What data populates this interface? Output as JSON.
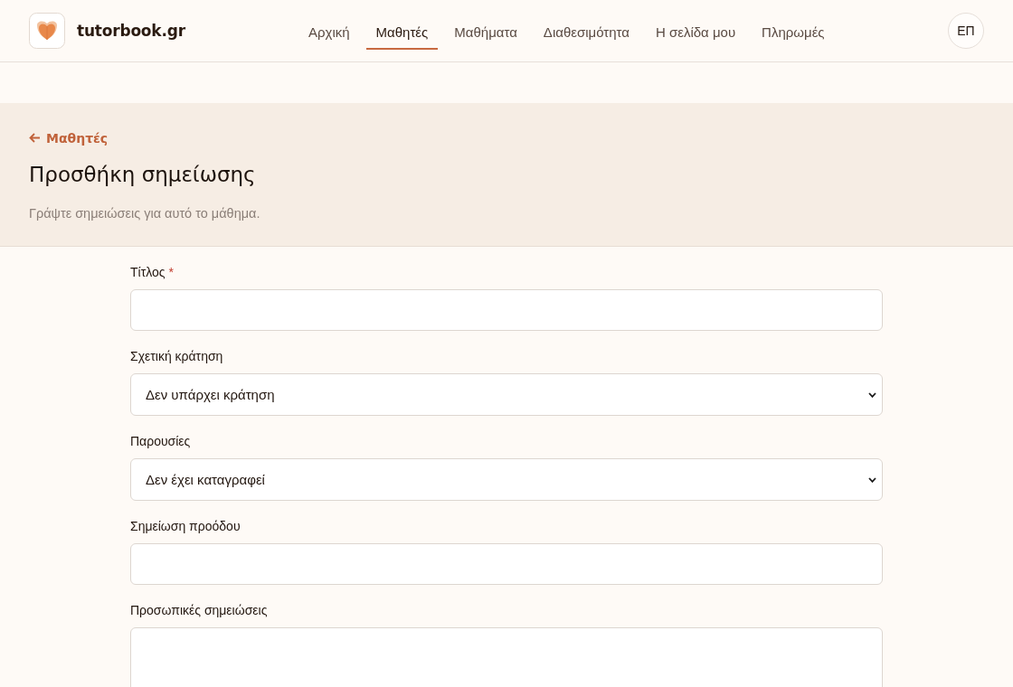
{
  "header": {
    "brand": "tutorbook.gr",
    "nav": [
      {
        "label": "Αρχική",
        "selected": false
      },
      {
        "label": "Μαθητές",
        "selected": true
      },
      {
        "label": "Μαθήματα",
        "selected": false
      },
      {
        "label": "Διαθεσιμότητα",
        "selected": false
      },
      {
        "label": "Η σελίδα μου",
        "selected": false
      },
      {
        "label": "Πληρωμές",
        "selected": false
      }
    ],
    "avatar": "ΕΠ"
  },
  "page_header": {
    "back_link": "Μαθητές",
    "title": "Προσθήκη σημείωσης",
    "subtitle": "Γράψτε σημειώσεις για αυτό το μάθημα."
  },
  "form": {
    "fields": [
      {
        "kind": "text",
        "label": "Τίτλος",
        "required_mark": "*"
      },
      {
        "kind": "select",
        "label": "Σχετική κράτηση",
        "value": "Δεν υπάρχει κράτηση"
      },
      {
        "kind": "select",
        "label": "Παρουσίες",
        "value": "Δεν έχει καταγραφεί"
      },
      {
        "kind": "text",
        "label": "Σημείωση προόδου"
      },
      {
        "kind": "textarea",
        "label": "Προσωπικές σημειώσεις"
      }
    ]
  }
}
